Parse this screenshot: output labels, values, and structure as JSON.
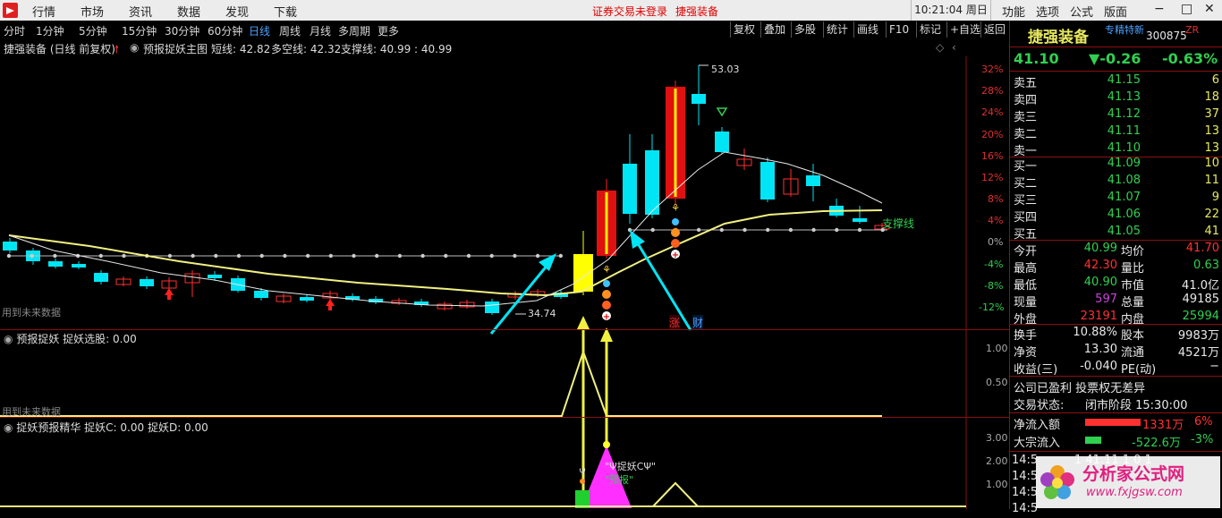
{
  "menubar": {
    "items": [
      "行情",
      "市场",
      "资讯",
      "数据",
      "发现",
      "下载"
    ],
    "warning": "证券交易未登录",
    "stock_link": "捷强装备",
    "clock": "10:21:04 周日",
    "right_items": [
      "功能",
      "选项",
      "公式",
      "版面"
    ],
    "win_buttons": [
      "−",
      "□",
      "✕"
    ]
  },
  "periods": {
    "items": [
      "分时",
      "1分钟",
      "5分钟",
      "15分钟",
      "30分钟",
      "60分钟",
      "日线",
      "周线",
      "月线",
      "多周期",
      "更多"
    ],
    "active": "日线",
    "right_buttons": [
      "复权",
      "叠加",
      "多股",
      "统计",
      "画线",
      "F10",
      "标记",
      "+自选",
      "返回"
    ]
  },
  "title": {
    "stock": "捷强装备 (日线 前复权)",
    "formula": "预报捉妖主图",
    "short_line": "短线: 42.82",
    "multi_line": "多空线: 42.32",
    "support": "支撑线: 40.99 : 40.99"
  },
  "main_chart": {
    "y_labels": [
      "32%",
      "28%",
      "24%",
      "20%",
      "16%",
      "12%",
      "8%",
      "4%",
      "0%",
      "-4%",
      "-8%",
      "-12%"
    ],
    "high_label": "53.03",
    "low_label": "34.74",
    "support_text": "支撑线",
    "future_text": "用到未来数据",
    "tag_zhang": "涨",
    "tag_cai": "财"
  },
  "sub1": {
    "name": "预报捉妖",
    "param": "捉妖选股: 0.00",
    "y_labels": [
      "1.00",
      "0.50"
    ],
    "future_text": "用到未来数据"
  },
  "sub2": {
    "name": "捉妖预报精华",
    "param_c": "捉妖C: 0.00",
    "param_d": "捉妖D: 0.00",
    "y_labels": [
      "3.00",
      "2.00",
      "1.00"
    ],
    "label1": "\"Ψ捉妖CΨ\"",
    "label2": "\"预报\""
  },
  "quote": {
    "name": "捷强装备",
    "tag": "专精特新",
    "code": "300875",
    "zr": "ZR",
    "price": "41.10",
    "change": "▼-0.26",
    "pct": "-0.63%",
    "asks": [
      {
        "label": "卖五",
        "price": "41.15",
        "vol": "6"
      },
      {
        "label": "卖四",
        "price": "41.13",
        "vol": "18"
      },
      {
        "label": "卖三",
        "price": "41.12",
        "vol": "37"
      },
      {
        "label": "卖二",
        "price": "41.11",
        "vol": "13"
      },
      {
        "label": "卖一",
        "price": "41.10",
        "vol": "13"
      }
    ],
    "bids": [
      {
        "label": "买一",
        "price": "41.09",
        "vol": "10"
      },
      {
        "label": "买二",
        "price": "41.08",
        "vol": "11"
      },
      {
        "label": "买三",
        "price": "41.07",
        "vol": "9"
      },
      {
        "label": "买四",
        "price": "41.06",
        "vol": "22"
      },
      {
        "label": "买五",
        "price": "41.05",
        "vol": "41"
      }
    ],
    "stats": [
      {
        "l1": "今开",
        "v1": "40.99",
        "l2": "均价",
        "v2": "41.70"
      },
      {
        "l1": "最高",
        "v1": "42.30",
        "l2": "量比",
        "v2": "0.63"
      },
      {
        "l1": "最低",
        "v1": "40.90",
        "l2": "市值",
        "v2": "41.0亿"
      },
      {
        "l1": "现量",
        "v1": "597",
        "l2": "总量",
        "v2": "49185"
      },
      {
        "l1": "外盘",
        "v1": "23191",
        "l2": "内盘",
        "v2": "25994"
      }
    ],
    "fund": [
      {
        "l1": "换手",
        "v1": "10.88%",
        "l2": "股本",
        "v2": "9983万"
      },
      {
        "l1": "净资",
        "v1": "13.30",
        "l2": "流通",
        "v2": "4521万"
      },
      {
        "l1": "收益(三)",
        "v1": "-0.040",
        "l2": "PE(动)",
        "v2": "−"
      }
    ],
    "profit_line": "公司已盈利 投票权无差异",
    "status_label": "交易状态:",
    "status_value": "闭市阶段 15:30:00",
    "flow": [
      {
        "label": "净流入额",
        "value": "1331万",
        "pct": "6%"
      },
      {
        "label": "大宗流入",
        "value": "-522.6万",
        "pct": "-3%"
      }
    ],
    "ticks": [
      {
        "time": "14:5",
        "rest": "1 41.11   1  0  1"
      },
      {
        "time": "14:5",
        "rest": ""
      },
      {
        "time": "14:5",
        "rest": ""
      },
      {
        "time": "14:5",
        "rest": ""
      }
    ]
  },
  "watermark": {
    "title": "分析家公式网",
    "url": "www.fxjgsw.com"
  }
}
